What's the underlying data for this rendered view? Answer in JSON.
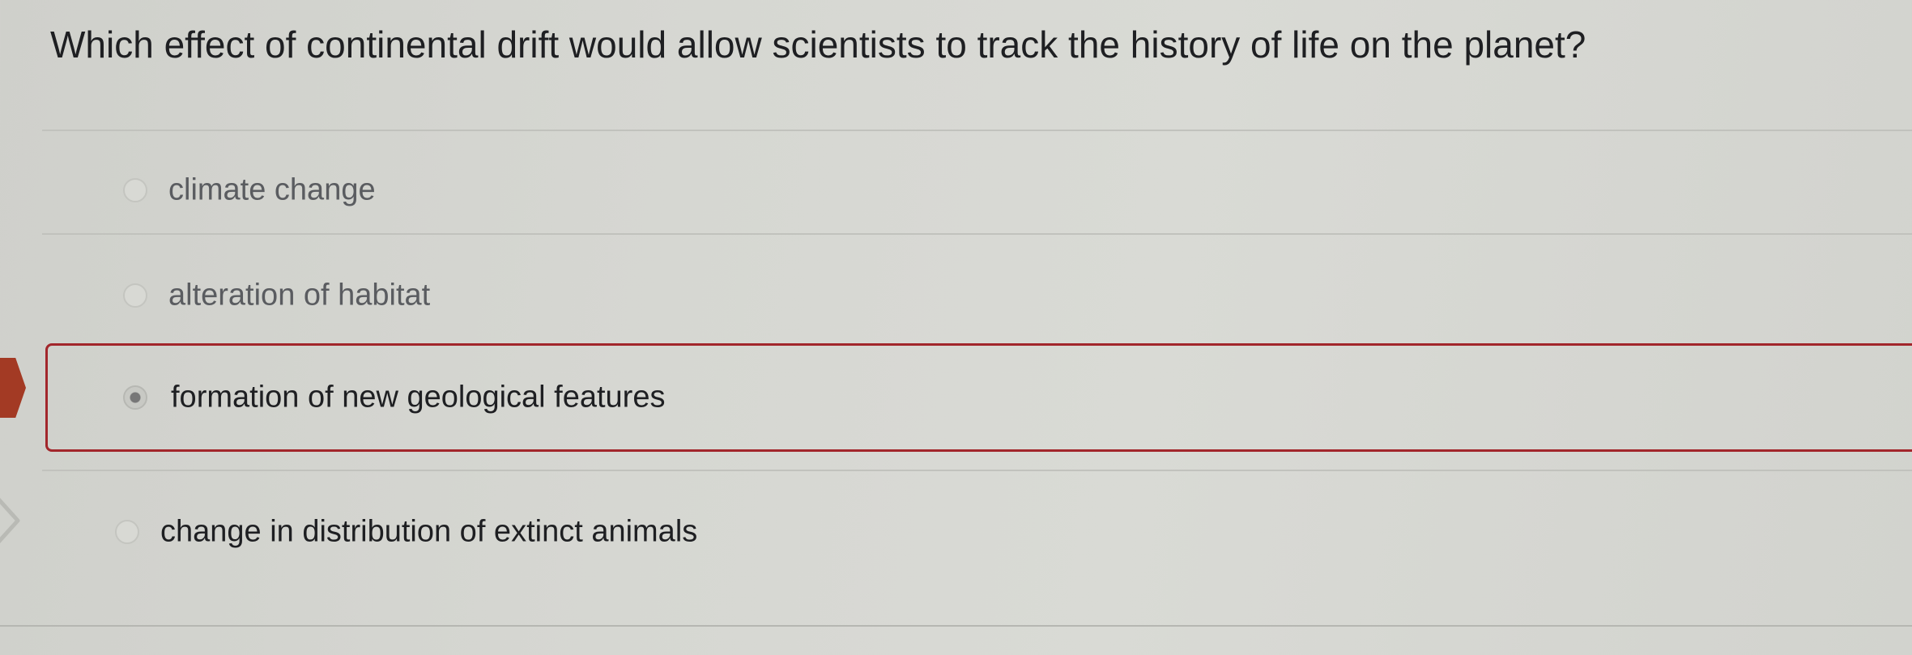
{
  "question": {
    "text": "Which effect of continental drift would allow scientists to track the history of life on the planet?"
  },
  "options": [
    {
      "label": "climate change",
      "selected": false
    },
    {
      "label": "alteration of habitat",
      "selected": false
    },
    {
      "label": "formation of new geological features",
      "selected": true
    },
    {
      "label": "change in distribution of extinct animals",
      "selected": false
    }
  ],
  "colors": {
    "selected_border": "#a2262b",
    "selected_marker": "#a33a24",
    "background": "#d6d7d2",
    "text": "#1e1f22"
  },
  "icons": {
    "selected_marker": "selected-answer-flag-icon",
    "side_nav": "chevron-right-icon"
  }
}
